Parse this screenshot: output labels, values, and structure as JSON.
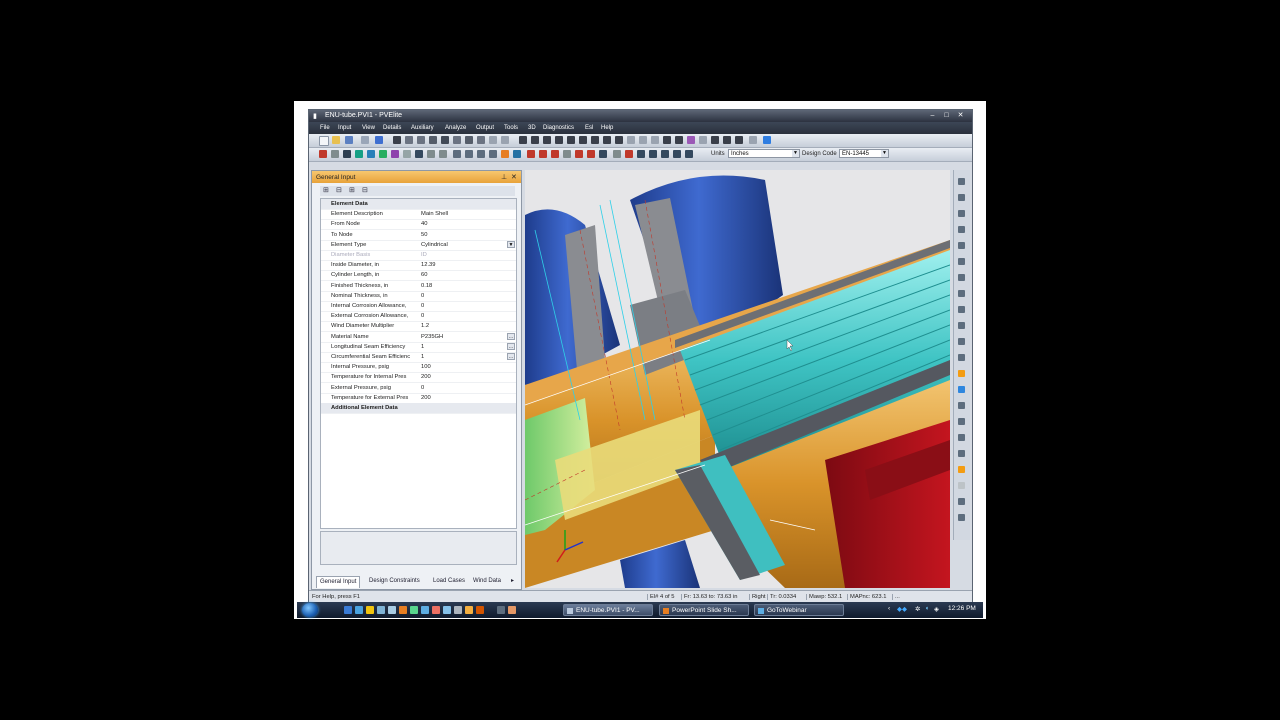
{
  "window": {
    "title": "ENU-tube.PVI1 - PVElite"
  },
  "menu": [
    "File",
    "Input",
    "View",
    "Details",
    "Auxiliary",
    "Analyze",
    "Output",
    "Tools",
    "3D",
    "Diagnostics",
    "Esl",
    "Help"
  ],
  "toolbar": {
    "units_label": "Units",
    "units_value": "Inches",
    "design_code_label": "Design Code",
    "design_code_value": "EN-13445"
  },
  "panel": {
    "title": "General Input",
    "rows": [
      {
        "key": "Element Data",
        "value": "",
        "type": "header"
      },
      {
        "key": "Element Description",
        "value": "Main Shell"
      },
      {
        "key": "From Node",
        "value": "40"
      },
      {
        "key": "To Node",
        "value": "50"
      },
      {
        "key": "Element Type",
        "value": "Cylindrical",
        "dropdown": true
      },
      {
        "key": "Diameter Basis",
        "value": "ID",
        "disabled": true
      },
      {
        "key": "Inside Diameter, in",
        "value": "12.39"
      },
      {
        "key": "Cylinder Length, in",
        "value": "60"
      },
      {
        "key": "Finished Thickness, in",
        "value": "0.18"
      },
      {
        "key": "Nominal Thickness, in",
        "value": "0"
      },
      {
        "key": "Internal Corrosion Allowance,",
        "value": "0"
      },
      {
        "key": "External Corrosion Allowance,",
        "value": "0"
      },
      {
        "key": "Wind Diameter Multiplier",
        "value": "1.2"
      },
      {
        "key": "Material Name",
        "value": "P235GH",
        "button": true
      },
      {
        "key": "Longitudinal Seam Efficiency",
        "value": "1",
        "button": true
      },
      {
        "key": "Circumferential Seam Efficienc",
        "value": "1",
        "button": true
      },
      {
        "key": "Internal Pressure,  psig",
        "value": "100"
      },
      {
        "key": "Temperature for Internal Pres",
        "value": "200"
      },
      {
        "key": "External Pressure,  psig",
        "value": "0"
      },
      {
        "key": "Temperature for External Pres",
        "value": "200"
      },
      {
        "key": "Additional Element Data",
        "value": "",
        "type": "header"
      }
    ],
    "tabs": [
      "General Input",
      "Design Constraints",
      "Load Cases",
      "Wind Data"
    ]
  },
  "status": {
    "help": "For Help, press F1",
    "element": "El# 4 of 5",
    "from_to": "Fr: 13.63 to: 73.63 in",
    "view": "Right",
    "tr": "Tr: 0.0334",
    "mawp": "Mawp: 532.1",
    "mapnc": "MAPnc: 623.1",
    "more": "..."
  },
  "taskbar": {
    "tasks": [
      "ENU-tube.PVI1 - PV...",
      "PowerPoint Slide Sh...",
      "GoToWebinar"
    ],
    "clock": "12:26 PM"
  },
  "colors": {
    "panel_title": "#e8a23a",
    "shell_orange": "#d9932a",
    "nozzle_blue": "#2f56b6",
    "tubes_cyan": "#3fc4c4",
    "flange_red": "#b3121c"
  }
}
